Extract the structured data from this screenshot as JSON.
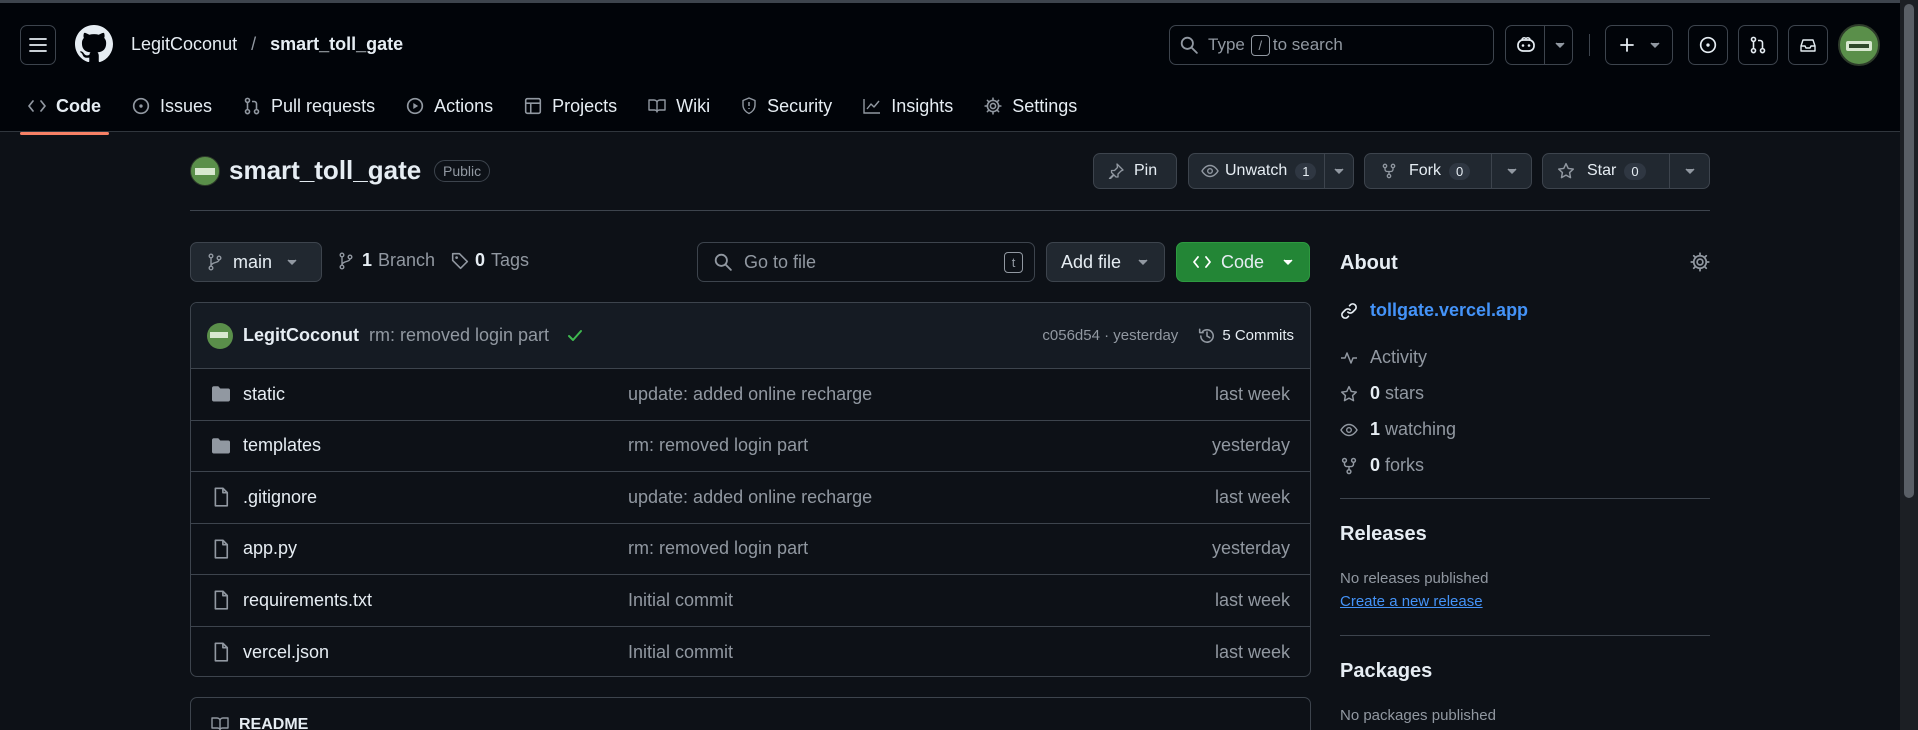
{
  "header": {
    "owner": "LegitCoconut",
    "separator": "/",
    "repo": "smart_toll_gate",
    "search_prefix": "Type",
    "search_key": "/",
    "search_suffix": "to search"
  },
  "tabs": [
    {
      "label": "Code",
      "icon": "code-icon",
      "active": true
    },
    {
      "label": "Issues",
      "icon": "issue-icon"
    },
    {
      "label": "Pull requests",
      "icon": "pull-request-icon"
    },
    {
      "label": "Actions",
      "icon": "play-icon"
    },
    {
      "label": "Projects",
      "icon": "table-icon"
    },
    {
      "label": "Wiki",
      "icon": "book-icon"
    },
    {
      "label": "Security",
      "icon": "shield-icon"
    },
    {
      "label": "Insights",
      "icon": "graph-icon"
    },
    {
      "label": "Settings",
      "icon": "gear-icon"
    }
  ],
  "repo_header": {
    "name": "smart_toll_gate",
    "visibility": "Public",
    "pin": "Pin",
    "unwatch": "Unwatch",
    "watch_count": "1",
    "fork": "Fork",
    "fork_count": "0",
    "star": "Star",
    "star_count": "0"
  },
  "toolbar": {
    "branch": "main",
    "branch_count": "1",
    "branch_label": "Branch",
    "tag_count": "0",
    "tag_label": "Tags",
    "goto_placeholder": "Go to file",
    "goto_key": "t",
    "add_file": "Add file",
    "code": "Code"
  },
  "latest_commit": {
    "author": "LegitCoconut",
    "message": "rm: removed login part",
    "hash": "c056d54 · yesterday",
    "commits": "5 Commits"
  },
  "files": [
    {
      "name": "static",
      "type": "folder",
      "message": "update: added online recharge",
      "date": "last week"
    },
    {
      "name": "templates",
      "type": "folder",
      "message": "rm: removed login part",
      "date": "yesterday"
    },
    {
      "name": ".gitignore",
      "type": "file",
      "message": "update: added online recharge",
      "date": "last week"
    },
    {
      "name": "app.py",
      "type": "file",
      "message": "rm: removed login part",
      "date": "yesterday"
    },
    {
      "name": "requirements.txt",
      "type": "file",
      "message": "Initial commit",
      "date": "last week"
    },
    {
      "name": "vercel.json",
      "type": "file",
      "message": "Initial commit",
      "date": "last week"
    }
  ],
  "readme": {
    "label": "README"
  },
  "about": {
    "title": "About",
    "link": "tollgate.vercel.app",
    "activity": "Activity",
    "stars_count": "0",
    "stars_label": "stars",
    "watching_count": "1",
    "watching_label": "watching",
    "forks_count": "0",
    "forks_label": "forks"
  },
  "releases": {
    "title": "Releases",
    "none": "No releases published",
    "create": "Create a new release"
  },
  "packages": {
    "title": "Packages",
    "none": "No packages published"
  },
  "colors": {
    "background": "#0d1117",
    "header": "#010409",
    "accent_green": "#238636",
    "link_blue": "#4493f8",
    "tab_underline": "#f78166"
  }
}
